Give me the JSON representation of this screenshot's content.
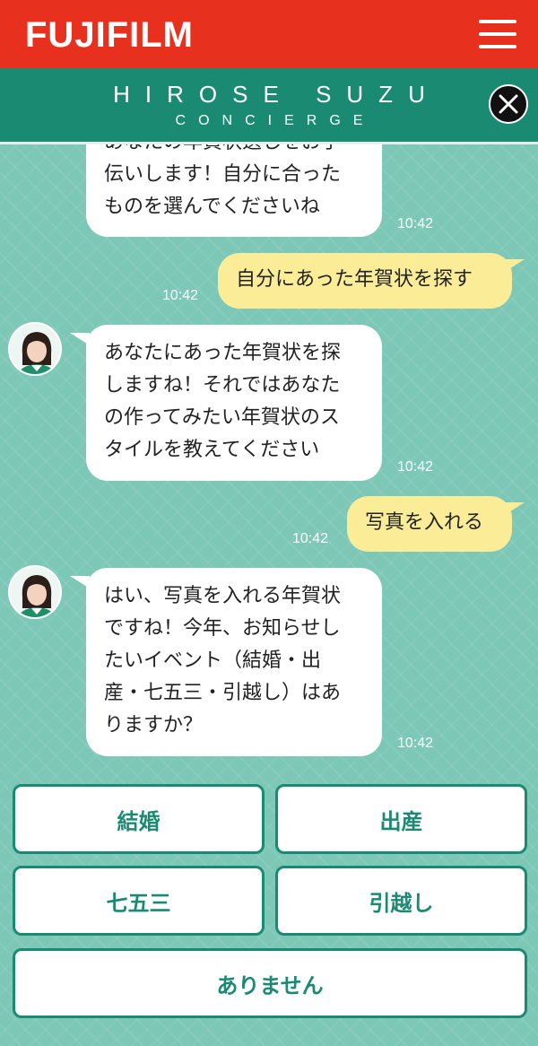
{
  "header": {
    "logo": "FUJIFILM",
    "title": "HIROSE SUZU",
    "subtitle": "CONCIERGE",
    "menu_icon": "hamburger-menu-icon",
    "close_icon": "close-icon"
  },
  "messages": [
    {
      "from": "bot",
      "text": "あなたの年賀状選しをお手\n伝いします！自分に合った\nものを選んでくださいね",
      "time": "10:42"
    },
    {
      "from": "user",
      "text": "自分にあった年賀状を探す",
      "time": "10:42"
    },
    {
      "from": "bot",
      "text": "あなたにあった年賀状を探\nしますね！それではあなた\nの作ってみたい年賀状のス\nタイルを教えてください",
      "time": "10:42"
    },
    {
      "from": "user",
      "text": "写真を入れる",
      "time": "10:42"
    },
    {
      "from": "bot",
      "text": "はい、写真を入れる年賀状\nですね！今年、お知らせし\nたいイベント（結婚・出\n産・七五三・引越し）はあ\nりますか？",
      "time": "10:42"
    }
  ],
  "options": [
    "結婚",
    "出産",
    "七五三",
    "引越し",
    "ありません"
  ],
  "colors": {
    "brand_red": "#e8301f",
    "brand_green": "#1a8a73",
    "chat_bg": "#7cc7b6",
    "user_bubble": "#fbed98"
  }
}
